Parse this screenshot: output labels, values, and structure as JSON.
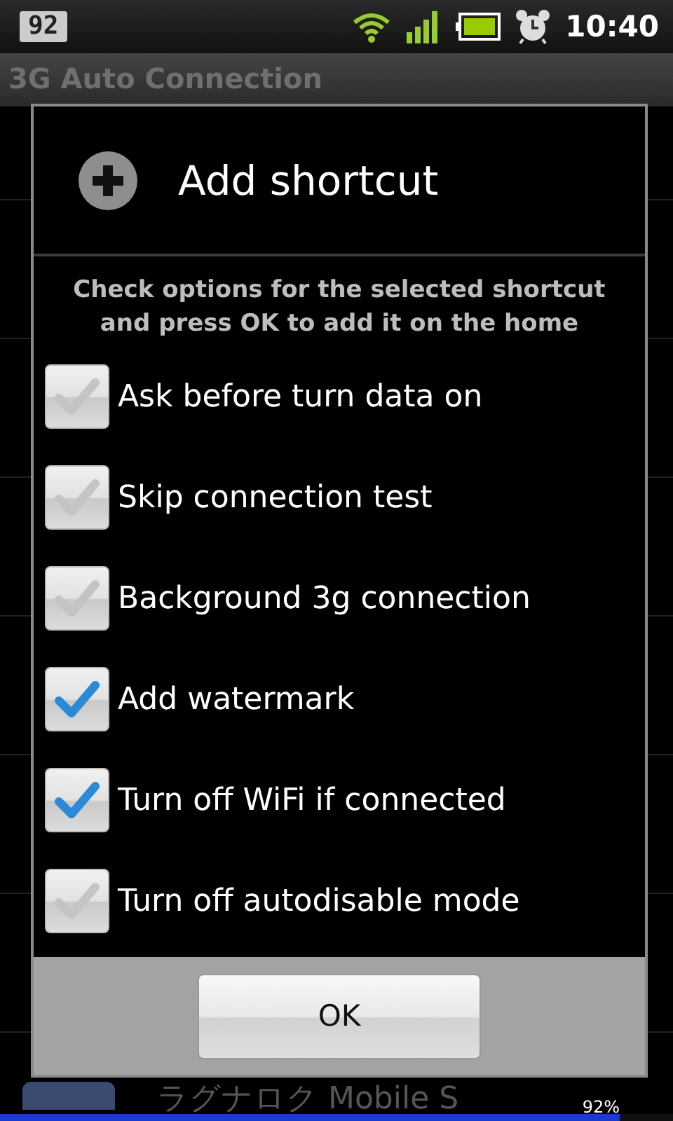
{
  "status_bar": {
    "notification": "92",
    "time": "10:40"
  },
  "app_bar": {
    "title": "3G Auto Connection"
  },
  "app_list": {
    "items": [
      {
        "kind": "app",
        "name": "ラグナロク Mobile S"
      }
    ]
  },
  "dialog": {
    "title": "Add shortcut",
    "message": "Check options for the selected shortcut and press OK to add it on the home",
    "options": [
      {
        "label": "Ask before turn data on",
        "checked": false
      },
      {
        "label": "Skip connection test",
        "checked": false
      },
      {
        "label": "Background 3g connection",
        "checked": false
      },
      {
        "label": "Add watermark",
        "checked": true
      },
      {
        "label": "Turn off WiFi if connected",
        "checked": true
      },
      {
        "label": "Turn off autodisable mode",
        "checked": false
      }
    ],
    "buttons": [
      "OK"
    ]
  },
  "download": {
    "reading": "92%",
    "level": 0.92
  }
}
